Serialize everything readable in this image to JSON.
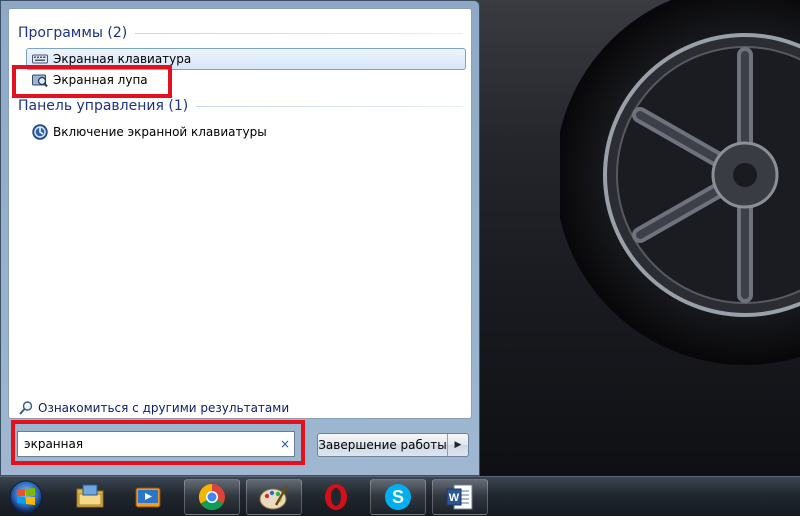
{
  "start_menu": {
    "groups": [
      {
        "title": "Программы (2)",
        "items": [
          {
            "label": "Экранная клавиатура",
            "icon": "keyboard-icon",
            "selected": true
          },
          {
            "label": "Экранная лупа",
            "icon": "magnifier-app-icon",
            "selected": false
          }
        ]
      },
      {
        "title": "Панель управления (1)",
        "items": [
          {
            "label": "Включение экранной клавиатуры",
            "icon": "ease-of-access-icon",
            "selected": false
          }
        ]
      }
    ],
    "more_results": "Ознакомиться с другими результатами",
    "search": {
      "value": "экранная",
      "clear_glyph": "×"
    },
    "shutdown": {
      "label": "Завершение работы",
      "arrow": "▶"
    }
  },
  "taskbar": {
    "pinned": [
      {
        "name": "windows-explorer-icon",
        "active": false
      },
      {
        "name": "media-player-icon",
        "active": false
      },
      {
        "name": "chrome-icon",
        "active": true
      },
      {
        "name": "paint-icon",
        "active": true
      },
      {
        "name": "opera-icon",
        "active": false
      },
      {
        "name": "skype-icon",
        "active": true
      },
      {
        "name": "word-icon",
        "active": true
      }
    ]
  },
  "colors": {
    "group_header": "#1e3287",
    "highlight": "#e3111d"
  }
}
